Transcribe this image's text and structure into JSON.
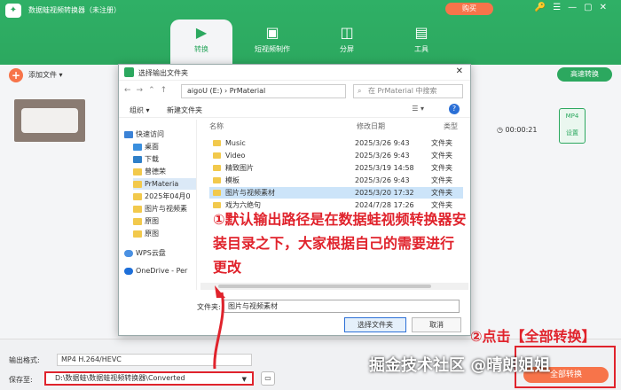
{
  "app": {
    "title": "数据蛙视频转换器（未注册）",
    "buy_label": "购买"
  },
  "nav": [
    {
      "label": "转换",
      "icon": "convert-icon",
      "active": true
    },
    {
      "label": "短视频制作",
      "icon": "image-icon",
      "active": false
    },
    {
      "label": "分屏",
      "icon": "split-screen-icon",
      "active": false
    },
    {
      "label": "工具",
      "icon": "toolbox-icon",
      "active": false
    }
  ],
  "toolbar": {
    "add_label": "添加文件",
    "high_speed_label": "高速转换"
  },
  "file": {
    "duration": "00:00:21",
    "format": "MP4",
    "format_btn": "设置"
  },
  "dialog": {
    "title": "选择输出文件夹",
    "path": "aigoU (E:) › PrMaterial",
    "search_placeholder": "在 PrMaterial 中搜索",
    "organize": "组织 ▾",
    "new_folder": "新建文件夹",
    "nav_items": [
      "快速访问",
      "桌面",
      "下载",
      "曾德荣",
      "PrMateria",
      "2025年04月0",
      "图片与视频素",
      "原图",
      "原图",
      "WPS云盘",
      "OneDrive - Per"
    ],
    "columns": {
      "name": "名称",
      "date": "修改日期",
      "type": "类型"
    },
    "rows": [
      {
        "name": "Music",
        "date": "2025/3/26 9:43",
        "type": "文件夹"
      },
      {
        "name": "Video",
        "date": "2025/3/26 9:43",
        "type": "文件夹"
      },
      {
        "name": "精致图片",
        "date": "2025/3/19 14:58",
        "type": "文件夹"
      },
      {
        "name": "模板",
        "date": "2025/3/26 9:43",
        "type": "文件夹"
      },
      {
        "name": "图片与视频素材",
        "date": "2025/3/20 17:32",
        "type": "文件夹"
      },
      {
        "name": "戏为六绝句",
        "date": "2024/7/28 17:26",
        "type": "文件夹"
      }
    ],
    "folder_label": "文件夹:",
    "folder_value": "图片与视频素材",
    "select_btn": "选择文件夹",
    "cancel_btn": "取消"
  },
  "annotation1": "①默认输出路径是在数据蛙视频转换器安装目录之下，大家根据自己的需要进行更改",
  "annotation2": "②点击【全部转换】",
  "bottom": {
    "format_label": "输出格式:",
    "format_value": "MP4 H.264/HEVC",
    "save_label": "保存至:",
    "save_path": "D:\\数据蛙\\数据蛙视频转换器\\Converted",
    "convert_all": "全部转换"
  },
  "watermark": "掘金技术社区 @晴朗姐姐",
  "colors": {
    "brand": "#2ca85f",
    "accent": "#f7744a",
    "annotation": "#e0232c"
  }
}
